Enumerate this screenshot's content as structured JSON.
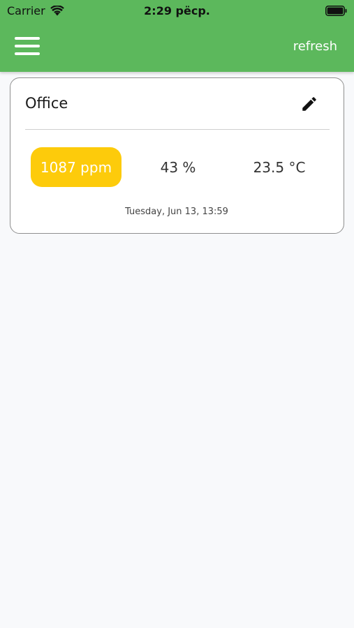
{
  "status_bar": {
    "carrier": "Carrier",
    "time": "2:29 рёср.",
    "wifi_icon": "wifi-icon",
    "battery_icon": "battery-icon"
  },
  "header": {
    "menu_icon": "hamburger-menu-icon",
    "refresh_label": "refresh",
    "background_color": "#5cb85c"
  },
  "card": {
    "title": "Office",
    "edit_icon": "pencil-icon",
    "co2": "1087 ppm",
    "co2_badge_color": "#fdcb0b",
    "humidity": "43 %",
    "temperature": "23.5 °C",
    "timestamp": "Tuesday, Jun 13, 13:59"
  }
}
